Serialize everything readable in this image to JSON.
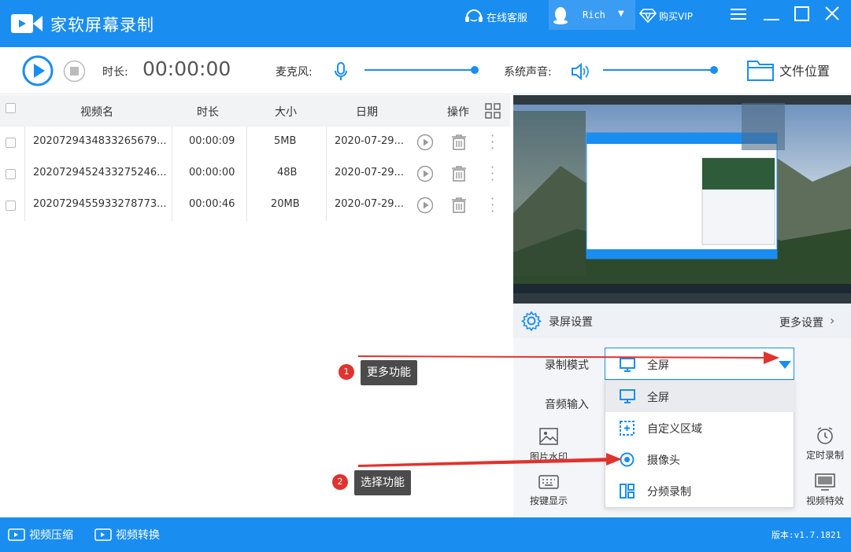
{
  "title_bar": {
    "app_title": "家软屏幕录制",
    "online_service": "在线客服",
    "user_name": "Rich",
    "buy_vip": "购买VIP"
  },
  "toolbar": {
    "duration_label": "时长:",
    "duration_value": "00:00:00",
    "mic_label": "麦克风:",
    "system_sound_label": "系统声音:",
    "file_location": "文件位置"
  },
  "table": {
    "headers": [
      "视频名",
      "时长",
      "大小",
      "日期",
      "操作"
    ],
    "rows": [
      {
        "name": "2020729434833265679...",
        "duration": "00:00:09",
        "size": "5MB",
        "date": "2020-07-29..."
      },
      {
        "name": "2020729452433275246...",
        "duration": "00:00:00",
        "size": "48B",
        "date": "2020-07-29..."
      },
      {
        "name": "2020729455933278773...",
        "duration": "00:00:46",
        "size": "20MB",
        "date": "2020-07-29..."
      }
    ]
  },
  "settings": {
    "header": "录屏设置",
    "more_settings": "更多设置",
    "mode_label": "录制模式",
    "mode_selected": "全屏",
    "audio_label": "音频输入",
    "dropdown_options": [
      "全屏",
      "自定义区域",
      "摄像头",
      "分频录制"
    ],
    "tools_left": [
      "图片水印",
      "按键显示"
    ],
    "tools_right": [
      "定时录制",
      "视频特效"
    ]
  },
  "annotations": {
    "badge1": "1",
    "tip1": "更多功能",
    "badge2": "2",
    "tip2": "选择功能"
  },
  "bottom_bar": {
    "compress": "视频压缩",
    "convert": "视频转换",
    "version": "版本:v1.7.1821"
  },
  "colors": {
    "brand": "#1a8df1",
    "arrow": "#e0332f"
  }
}
